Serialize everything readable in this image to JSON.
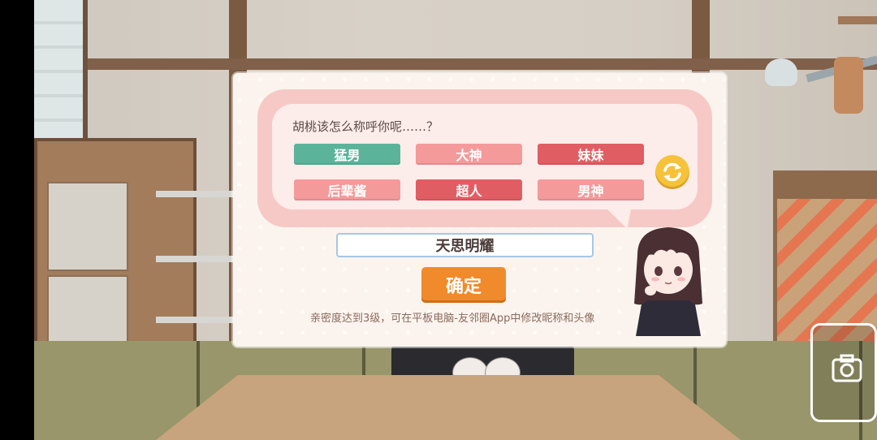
{
  "dialog": {
    "prompt": "胡桃该怎么称呼你呢……？",
    "options": [
      {
        "label": "猛男",
        "color": "#5bb49a"
      },
      {
        "label": "大神",
        "color": "#f49a9a"
      },
      {
        "label": "妹妹",
        "color": "#e05e63"
      },
      {
        "label": "后辈酱",
        "color": "#f49a9a"
      },
      {
        "label": "超人",
        "color": "#e05e63"
      },
      {
        "label": "男神",
        "color": "#f49a9a"
      }
    ],
    "refresh_icon": "refresh-icon",
    "name_value": "天思明耀",
    "confirm_label": "确定",
    "note": "亲密度达到3级，可在平板电脑-友邻圈App中修改昵称和头像"
  },
  "camera_icon": "camera-icon",
  "colors": {
    "dialog_bg": "#fbf4ee",
    "bubble_outer": "#f6c9c6",
    "bubble_inner": "#fcecea",
    "confirm": "#f08a2a",
    "refresh": "#f5c23a"
  }
}
